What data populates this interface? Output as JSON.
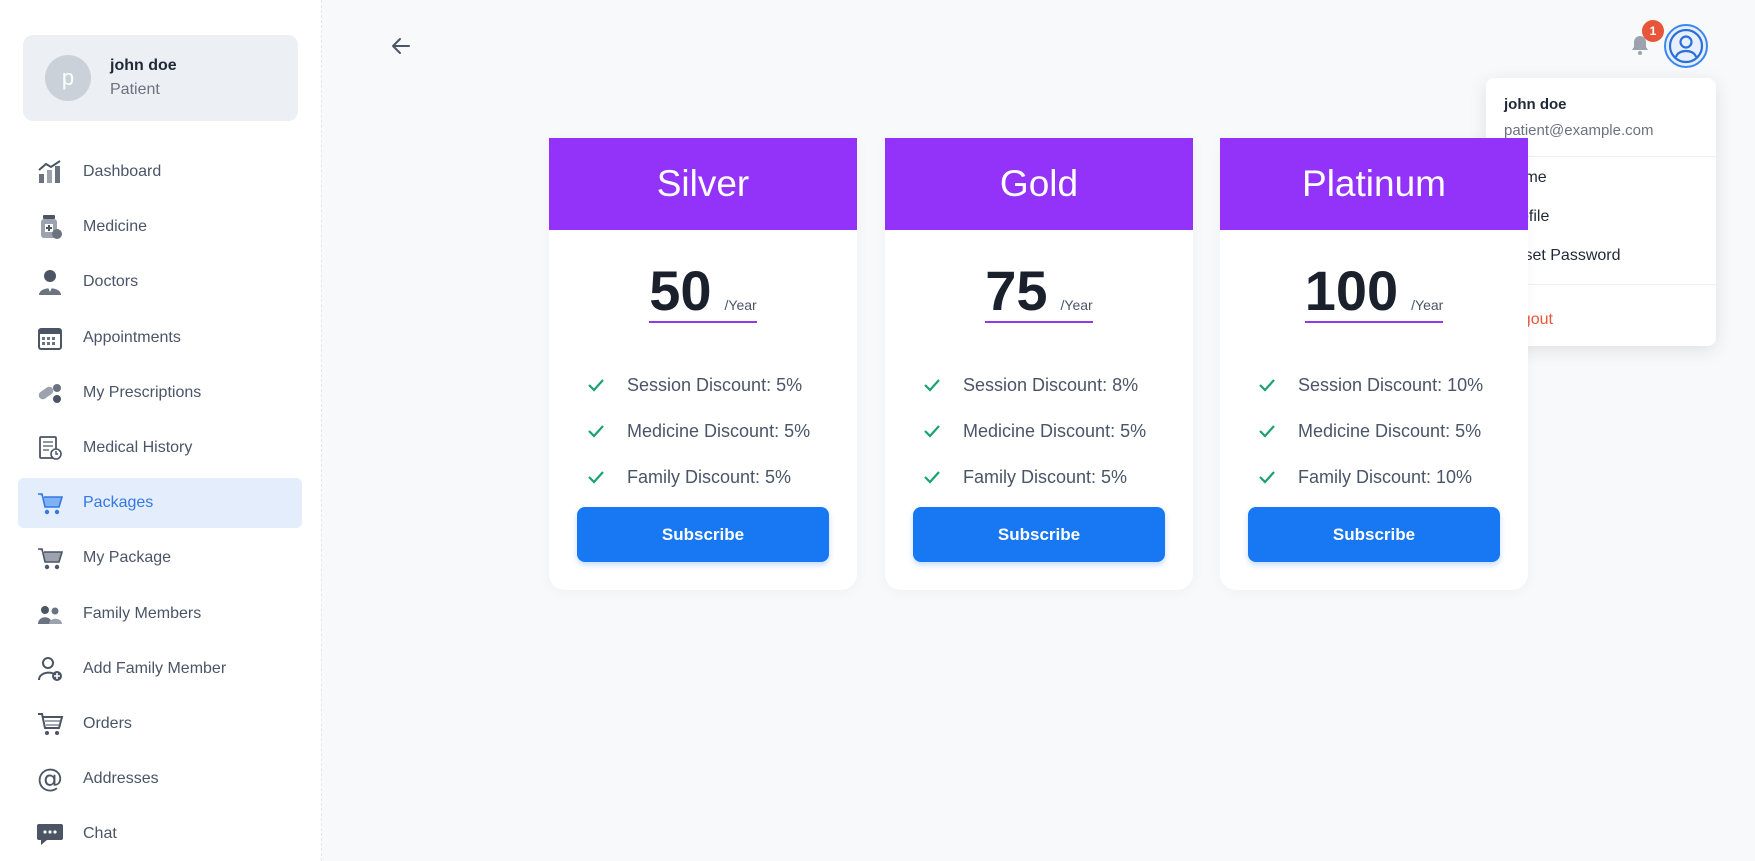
{
  "user": {
    "initial": "p",
    "name": "john doe",
    "role": "Patient"
  },
  "sidebar": {
    "items": [
      {
        "label": "Dashboard",
        "icon": "chart-icon"
      },
      {
        "label": "Medicine",
        "icon": "medicine-icon"
      },
      {
        "label": "Doctors",
        "icon": "doctor-icon"
      },
      {
        "label": "Appointments",
        "icon": "calendar-icon"
      },
      {
        "label": "My Prescriptions",
        "icon": "pills-icon"
      },
      {
        "label": "Medical History",
        "icon": "document-clock-icon"
      },
      {
        "label": "Packages",
        "icon": "cart-icon",
        "active": true
      },
      {
        "label": "My Package",
        "icon": "cart-icon"
      },
      {
        "label": "Family Members",
        "icon": "family-icon"
      },
      {
        "label": "Add Family Member",
        "icon": "add-user-icon"
      },
      {
        "label": "Orders",
        "icon": "shopping-cart-icon"
      },
      {
        "label": "Addresses",
        "icon": "at-icon"
      },
      {
        "label": "Chat",
        "icon": "chat-icon"
      }
    ]
  },
  "header": {
    "back_icon": "arrow-left-icon",
    "notification_count": "1",
    "notification_icon": "bell-icon",
    "profile_icon": "user-circle-icon"
  },
  "dropdown": {
    "name": "john doe",
    "email": "patient@example.com",
    "items": [
      "Home",
      "Profile",
      "Reset Password"
    ],
    "logout": "Logout"
  },
  "packages": [
    {
      "name": "Silver",
      "price": "50",
      "period": "/Year",
      "features": [
        "Session Discount: 5%",
        "Medicine Discount: 5%",
        "Family Discount: 5%"
      ],
      "button": "Subscribe"
    },
    {
      "name": "Gold",
      "price": "75",
      "period": "/Year",
      "features": [
        "Session Discount: 8%",
        "Medicine Discount: 5%",
        "Family Discount: 5%"
      ],
      "button": "Subscribe"
    },
    {
      "name": "Platinum",
      "price": "100",
      "period": "/Year",
      "features": [
        "Session Discount: 10%",
        "Medicine Discount: 5%",
        "Family Discount: 10%"
      ],
      "button": "Subscribe"
    }
  ],
  "colors": {
    "accent": "#1877f2",
    "card_header": "#9333fa",
    "active_nav_bg": "#e3edfc",
    "check": "#1aa36f",
    "logout": "#e8563a"
  }
}
